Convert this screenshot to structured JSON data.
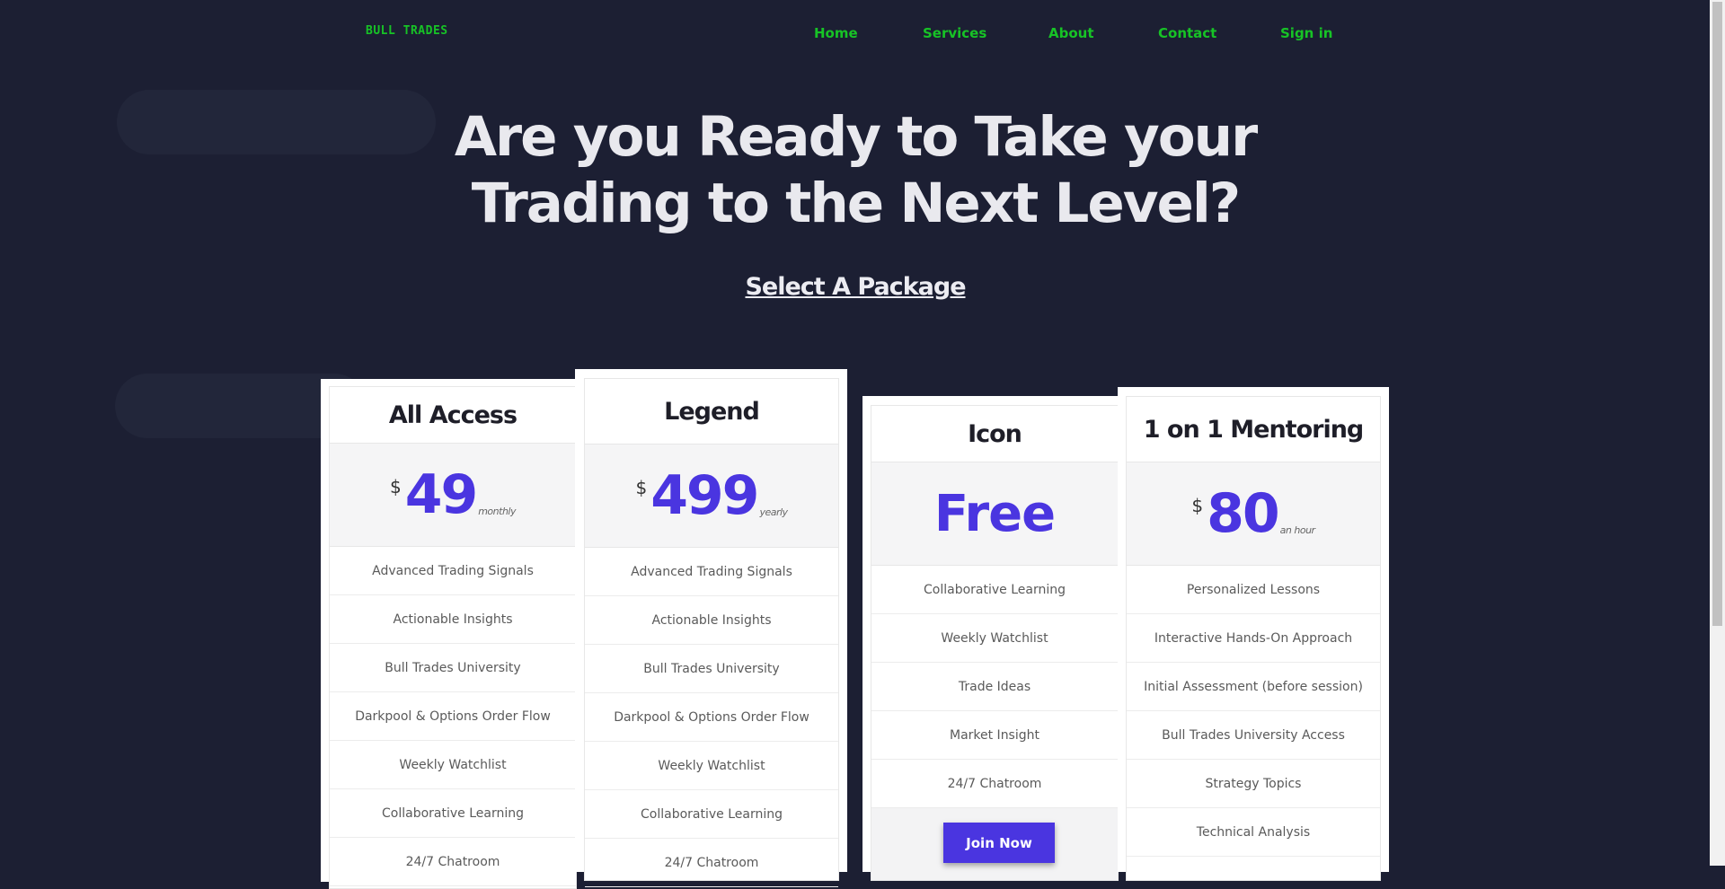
{
  "nav": {
    "logo": "BULL TRADES",
    "links": [
      "Home",
      "Services",
      "About",
      "Contact",
      "Sign in"
    ]
  },
  "hero": {
    "title": "Are you Ready to Take your Trading to the Next Level?",
    "subtitle": "Select A Package"
  },
  "cards": [
    {
      "name": "All Access",
      "currency": "$",
      "price": "49",
      "period": "monthly",
      "features": [
        "Advanced Trading Signals",
        "Actionable Insights",
        "Bull Trades University",
        "Darkpool & Options Order Flow",
        "Weekly Watchlist",
        "Collaborative Learning",
        "24/7 Chatroom"
      ]
    },
    {
      "name": "Legend",
      "currency": "$",
      "price": "499",
      "period": "yearly",
      "features": [
        "Advanced Trading Signals",
        "Actionable Insights",
        "Bull Trades University",
        "Darkpool & Options Order Flow",
        "Weekly Watchlist",
        "Collaborative Learning",
        "24/7 Chatroom"
      ]
    },
    {
      "name": "Icon",
      "price": "Free",
      "features": [
        "Collaborative Learning",
        "Weekly Watchlist",
        "Trade Ideas",
        "Market Insight",
        "24/7 Chatroom"
      ],
      "button": "Join Now"
    },
    {
      "name": "1 on 1 Mentoring",
      "currency": "$",
      "price": "80",
      "period": "an hour",
      "features": [
        "Personalized Lessons",
        "Interactive Hands-On Approach",
        "Initial Assessment (before session)",
        "Bull Trades University Access",
        "Strategy Topics",
        "Technical Analysis"
      ]
    }
  ],
  "colors": {
    "background": "#1c1f33",
    "nav_link": "#17c326",
    "accent": "#4a35e0"
  }
}
